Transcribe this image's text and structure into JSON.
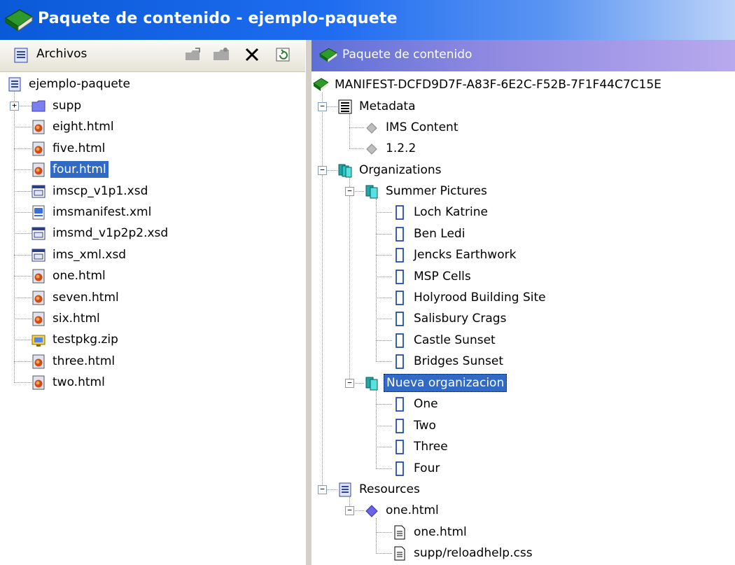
{
  "window": {
    "title": "Paquete de contenido - ejemplo-paquete"
  },
  "files_panel": {
    "header": "Archivos",
    "root": "ejemplo-paquete",
    "items": [
      {
        "label": "supp",
        "icon": "folder-icon"
      },
      {
        "label": "eight.html",
        "icon": "html-file-icon"
      },
      {
        "label": "five.html",
        "icon": "html-file-icon"
      },
      {
        "label": "four.html",
        "icon": "html-file-icon",
        "selected": true
      },
      {
        "label": "imscp_v1p1.xsd",
        "icon": "xsd-file-icon"
      },
      {
        "label": "imsmanifest.xml",
        "icon": "xml-file-icon"
      },
      {
        "label": "imsmd_v1p2p2.xsd",
        "icon": "xsd-file-icon"
      },
      {
        "label": "ims_xml.xsd",
        "icon": "xsd-file-icon"
      },
      {
        "label": "one.html",
        "icon": "html-file-icon"
      },
      {
        "label": "seven.html",
        "icon": "html-file-icon"
      },
      {
        "label": "six.html",
        "icon": "html-file-icon"
      },
      {
        "label": "testpkg.zip",
        "icon": "zip-file-icon"
      },
      {
        "label": "three.html",
        "icon": "html-file-icon"
      },
      {
        "label": "two.html",
        "icon": "html-file-icon"
      }
    ]
  },
  "package_panel": {
    "header": "Paquete de contenido",
    "manifest": "MANIFEST-DCFD9D7F-A83F-6E2C-F52B-7F1F44C7C15E",
    "metadata": {
      "label": "Metadata",
      "items": [
        "IMS Content",
        "1.2.2"
      ]
    },
    "organizations": {
      "label": "Organizations",
      "groups": [
        {
          "label": "Summer Pictures",
          "items": [
            "Loch Katrine",
            "Ben Ledi",
            "Jencks Earthwork",
            "MSP Cells",
            "Holyrood Building Site",
            "Salisbury Crags",
            "Castle Sunset",
            "Bridges Sunset"
          ]
        },
        {
          "label": "Nueva organizacion",
          "selected": true,
          "items": [
            "One",
            "Two",
            "Three",
            "Four"
          ]
        }
      ]
    },
    "resources": {
      "label": "Resources",
      "resource": "one.html",
      "files": [
        "one.html",
        "supp/reloadhelp.css"
      ]
    }
  }
}
